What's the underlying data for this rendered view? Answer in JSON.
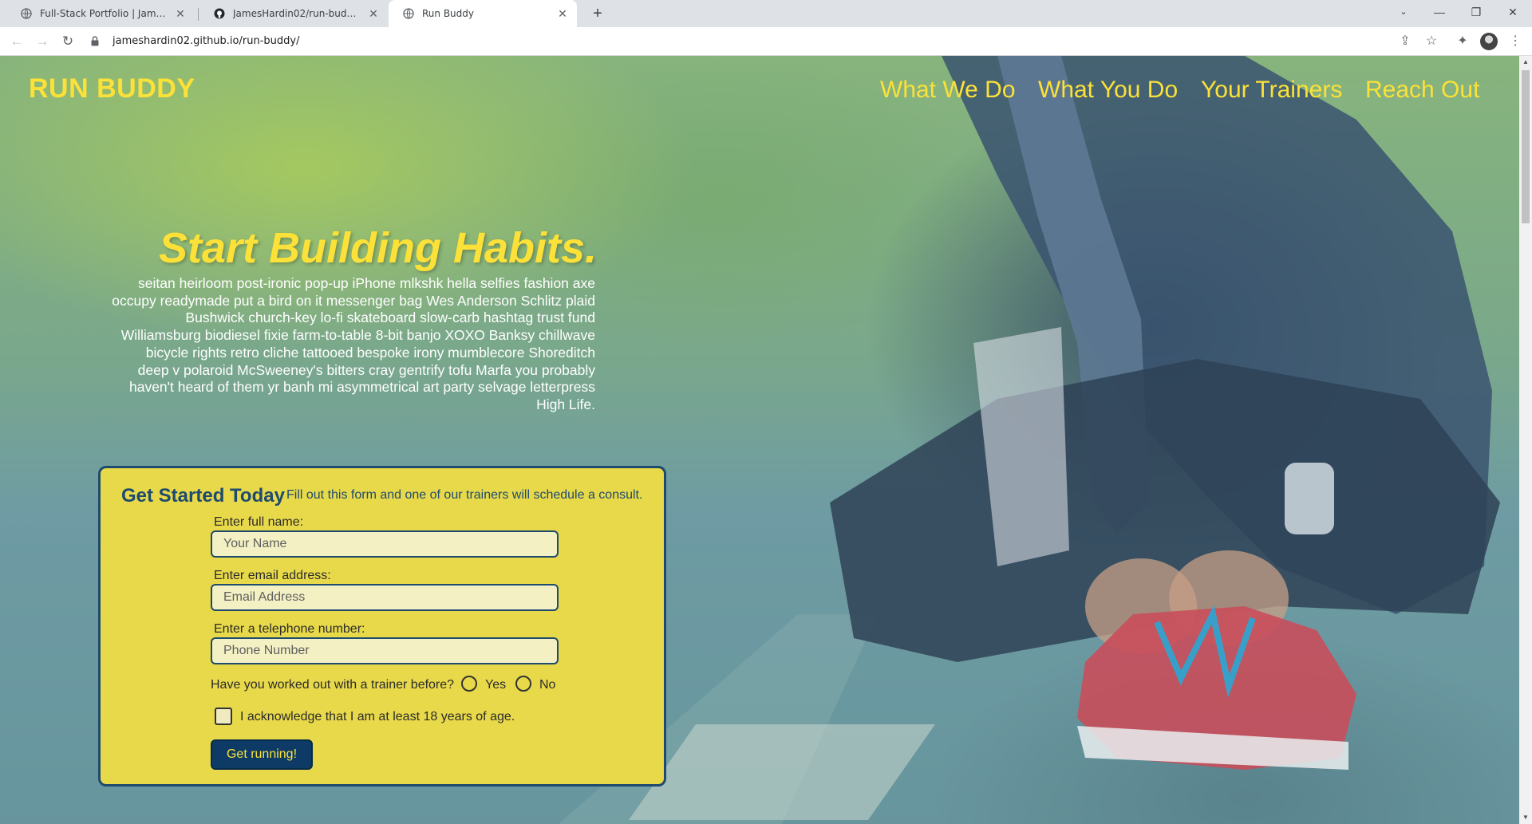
{
  "browser": {
    "tabs": [
      {
        "title": "Full-Stack Portfolio | James Hardin",
        "active": false
      },
      {
        "title": "JamesHardin02/run-buddy: Run Buddy",
        "active": false
      },
      {
        "title": "Run Buddy",
        "active": true
      }
    ],
    "new_tab": "+",
    "url": "jameshardin02.github.io/run-buddy/"
  },
  "site": {
    "logo": "RUN BUDDY",
    "nav": [
      "What We Do",
      "What You Do",
      "Your Trainers",
      "Reach Out"
    ],
    "accent_color": "#fce138",
    "primary_color": "#1e4a6e"
  },
  "hero": {
    "title": "Start Building Habits.",
    "lines": [
      "seitan heirloom post-ironic pop-up iPhone mlkshk hella selfies fashion axe",
      "occupy readymade put a bird on it messenger bag Wes Anderson Schlitz plaid",
      "Bushwick church-key lo-fi skateboard slow-carb hashtag trust fund",
      "Williamsburg biodiesel fixie farm-to-table 8-bit banjo XOXO Banksy chillwave",
      "bicycle rights retro cliche tattooed bespoke irony mumblecore Shoreditch",
      "deep v polaroid McSweeney's bitters cray gentrify tofu Marfa you probably",
      "haven't heard of them yr banh mi asymmetrical art party selvage letterpress",
      "High Life."
    ]
  },
  "form": {
    "heading": "Get Started Today",
    "subheading": "Fill out this form and one of our trainers will schedule a consult.",
    "name_label": "Enter full name:",
    "name_placeholder": "Your Name",
    "email_label": "Enter email address:",
    "email_placeholder": "Email Address",
    "phone_label": "Enter a telephone number:",
    "phone_placeholder": "Phone Number",
    "trainer_question": "Have you worked out with a trainer before?",
    "yes_label": "Yes",
    "no_label": "No",
    "age_ack": "I acknowledge that I am at least 18 years of age.",
    "submit_label": "Get running!"
  }
}
